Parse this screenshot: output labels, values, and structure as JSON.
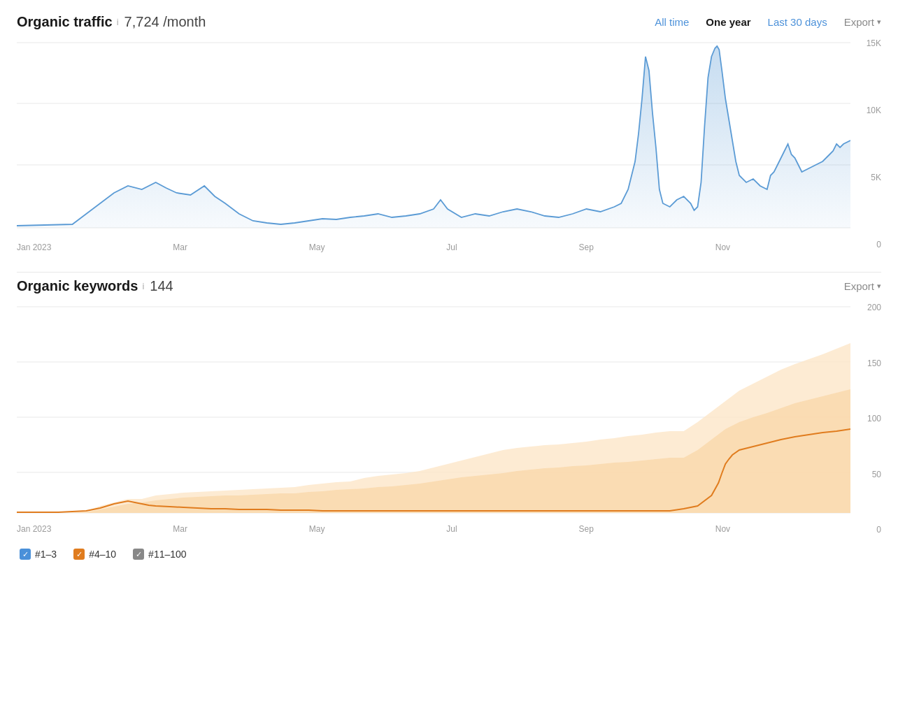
{
  "organic_traffic": {
    "title": "Organic traffic",
    "info_label": "i",
    "metric": "7,724 /month",
    "time_tabs": [
      {
        "id": "all-time",
        "label": "All time",
        "active": false
      },
      {
        "id": "one-year",
        "label": "One year",
        "active": true
      },
      {
        "id": "last-30",
        "label": "Last 30 days",
        "active": false
      }
    ],
    "export_label": "Export",
    "y_labels": [
      "15K",
      "10K",
      "5K",
      "0"
    ],
    "x_labels": [
      "Jan 2023",
      "Mar",
      "May",
      "Jul",
      "Sep",
      "Nov",
      ""
    ]
  },
  "organic_keywords": {
    "title": "Organic keywords",
    "info_label": "i",
    "metric": "144",
    "export_label": "Export",
    "y_labels": [
      "200",
      "150",
      "100",
      "50",
      "0"
    ],
    "x_labels": [
      "Jan 2023",
      "Mar",
      "May",
      "Jul",
      "Sep",
      "Nov",
      ""
    ],
    "legend": [
      {
        "id": "rank-1-3",
        "label": "#1–3",
        "color": "#e07c1e"
      },
      {
        "id": "rank-4-10",
        "label": "#4–10",
        "color": "#f5a623"
      },
      {
        "id": "rank-11-100",
        "label": "#11–100",
        "color": "#555"
      }
    ]
  },
  "colors": {
    "blue_line": "#5b9bd5",
    "blue_fill": "#d6e8f7",
    "orange_dark": "#e07c1e",
    "orange_light": "#fad6a5",
    "orange_fill": "#fde8cc"
  }
}
